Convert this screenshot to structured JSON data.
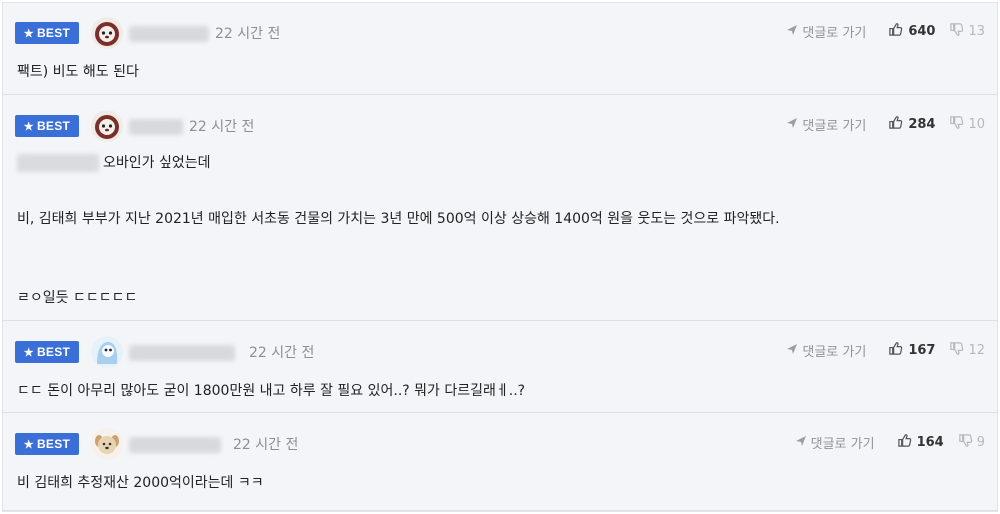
{
  "badge_label": "BEST",
  "reply_label": "댓글로 가기",
  "comments": [
    {
      "time": "22 시간 전",
      "likes": "640",
      "dislikes": "13",
      "lines": [
        "팩트) 비도 해도 된다"
      ]
    },
    {
      "time": "22 시간 전",
      "likes": "284",
      "dislikes": "10",
      "lines": [
        "오바인가 싶었는데",
        "비, 김태희 부부가 지난 2021년 매입한 서초동 건물의 가치는 3년 만에 500억 이상 상승해 1400억 원을 웃도는 것으로 파악됐다.",
        "ㄹㅇ일듯 ㄷㄷㄷㄷㄷ"
      ]
    },
    {
      "time": "22 시간 전",
      "likes": "167",
      "dislikes": "12",
      "lines": [
        "ㄷㄷ 돈이 아무리 많아도 굳이 1800만원 내고 하루 잘 필요 있어..? 뭐가 다르길래ㅔ..?"
      ]
    },
    {
      "time": "22 시간 전",
      "likes": "164",
      "dislikes": "9",
      "lines": [
        "비 김태희 추정재산 2000억이라는데 ㅋㅋ"
      ]
    }
  ],
  "colors": {
    "badge": "#3b6fd8",
    "panel": "#f4f5f8",
    "divider": "#dcdfe6"
  },
  "icons": [
    "star-icon",
    "reply-arrow-icon",
    "thumbs-up-icon",
    "thumbs-down-icon"
  ]
}
